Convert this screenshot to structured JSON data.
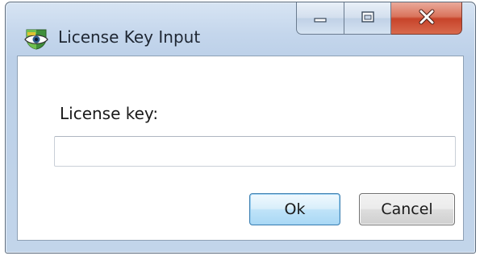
{
  "window": {
    "title": "License Key Input",
    "app_icon": "eye-shield-icon",
    "controls": {
      "minimize_icon": "minimize-icon",
      "maximize_icon": "maximize-icon",
      "close_icon": "close-icon"
    }
  },
  "form": {
    "label": "License key:",
    "input_value": "",
    "input_placeholder": ""
  },
  "buttons": {
    "ok_label": "Ok",
    "cancel_label": "Cancel"
  },
  "colors": {
    "titlebar": "#c4d6ec",
    "close_button": "#c7432a",
    "default_button_border": "#3c7fb1"
  }
}
